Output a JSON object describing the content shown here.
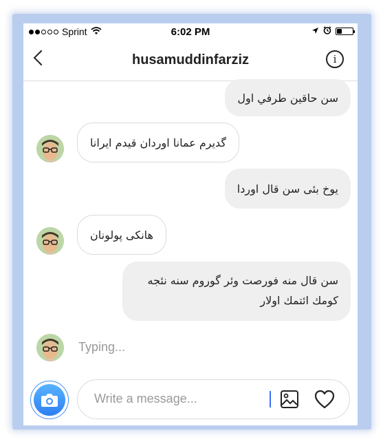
{
  "status_bar": {
    "carrier": "Sprint",
    "time": "6:02 PM",
    "signal_dots_filled": 2,
    "signal_dots_total": 5,
    "battery_level": 0.3
  },
  "header": {
    "title": "husamuddinfarziz",
    "info_label": "i"
  },
  "messages": [
    {
      "direction": "outgoing",
      "text": "سن حاقين طرفي اول"
    },
    {
      "direction": "incoming",
      "text": "گديرم عمانا اوردان قيدم ايرانا"
    },
    {
      "direction": "outgoing",
      "text": "يوخ بئی سن قال اوردا"
    },
    {
      "direction": "incoming",
      "text": "هانکی پولونان"
    },
    {
      "direction": "outgoing",
      "line1": "سن قال منه فورصت وئر گوروم سنه نئجه",
      "line2": "کومك ائتمك اولار"
    }
  ],
  "typing_indicator": "Typing...",
  "composer": {
    "placeholder": "Write a message..."
  },
  "icons": {
    "back": "chevron-left-icon",
    "info": "info-icon",
    "camera": "camera-icon",
    "gallery": "image-gallery-icon",
    "like": "heart-icon"
  },
  "colors": {
    "accent": "#3f8ff7",
    "outgoing_bubble": "#efefef",
    "incoming_border": "#dbdbdb",
    "frame": "#b9cdee"
  }
}
